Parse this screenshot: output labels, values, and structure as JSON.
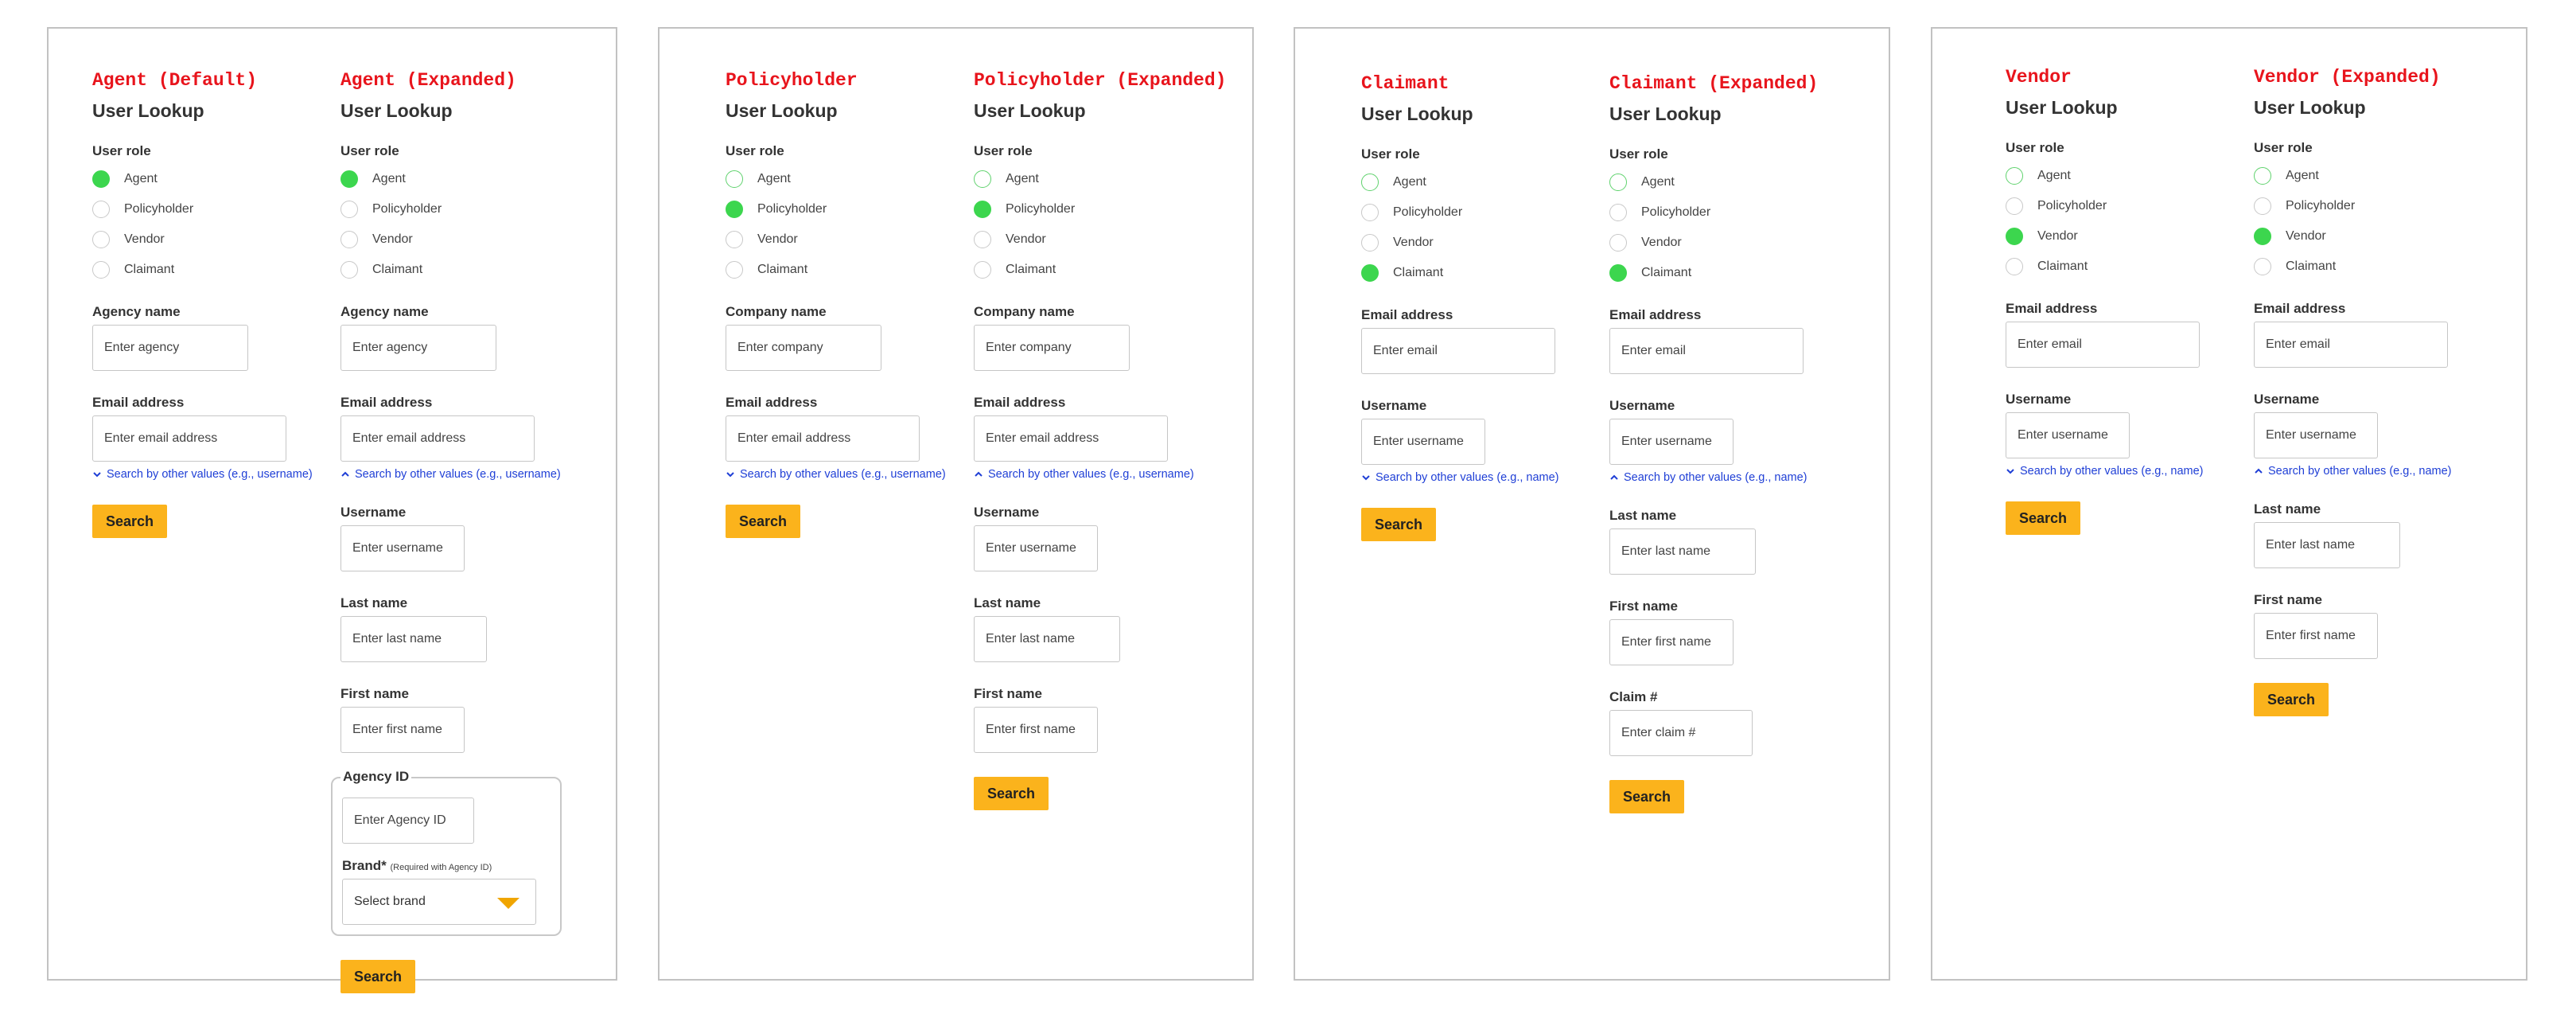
{
  "common": {
    "title": "User Lookup",
    "user_role_label": "User role",
    "roles": [
      "Agent",
      "Policyholder",
      "Vendor",
      "Claimant"
    ],
    "search_label": "Search",
    "agency_name_label": "Agency name",
    "agency_name_placeholder": "Enter agency",
    "company_name_label": "Company name",
    "company_name_placeholder": "Enter company",
    "email_label": "Email address",
    "email_placeholder_long": "Enter email address",
    "email_placeholder_short": "Enter email",
    "username_label": "Username",
    "username_placeholder": "Enter username",
    "last_name_label": "Last name",
    "last_name_placeholder": "Enter last name",
    "first_name_label": "First name",
    "first_name_placeholder": "Enter first name",
    "claim_label": "Claim #",
    "claim_placeholder": "Enter claim #",
    "agency_id_label": "Agency ID",
    "agency_id_placeholder": "Enter Agency ID",
    "brand_label": "Brand*",
    "brand_note": "(Required with Agency ID)",
    "brand_placeholder": "Select brand",
    "more_username": "Search by other values (e.g., username)",
    "more_name": "Search by other values (e.g., name)"
  },
  "headings": {
    "agent_default": "Agent (Default)",
    "agent_expanded": "Agent (Expanded)",
    "policyholder": "Policyholder",
    "policyholder_expanded": "Policyholder (Expanded)",
    "claimant": "Claimant",
    "claimant_expanded": "Claimant (Expanded)",
    "vendor": "Vendor",
    "vendor_expanded": "Vendor (Expanded)"
  },
  "colors": {
    "heading": "#e8141c",
    "selected_radio": "#3cd64e",
    "button": "#fbb31c",
    "link": "#1f3fd6"
  }
}
